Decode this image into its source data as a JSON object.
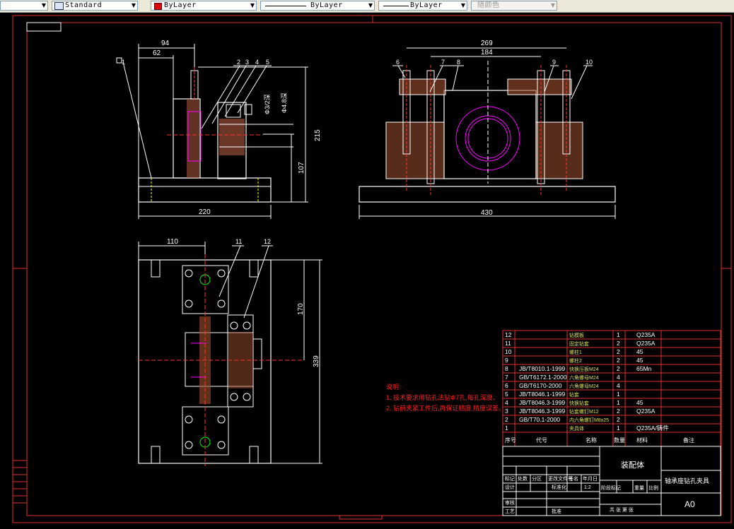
{
  "toolbar": {
    "textstyle": "Standard",
    "color": "ByLayer",
    "linetype": "ByLayer",
    "lineweight": "ByLayer",
    "plotstyle": "随颜色"
  },
  "drawing": {
    "front_view": {
      "dims": {
        "d94": "94",
        "d62": "62",
        "d220": "220",
        "d215": "215",
        "d107": "107",
        "phi": "Φ3/2深",
        "phi2": "Φ4.8深"
      },
      "balloons": [
        "1",
        "2",
        "3",
        "4",
        "5"
      ]
    },
    "side_view": {
      "dims": {
        "d269": "269",
        "d184": "184",
        "d430": "430"
      },
      "balloons": [
        "6",
        "7",
        "8",
        "9",
        "10"
      ]
    },
    "top_view": {
      "dims": {
        "d110": "110",
        "d170": "170",
        "d339": "339"
      },
      "balloons": [
        "11",
        "12"
      ]
    },
    "notes": {
      "title": "说明:",
      "line1": "1. 技术要求用钻孔法钻Φ7孔,每孔深度。",
      "line2": "2. 钻前夹紧工件后,再保证精度,精度误差。"
    },
    "bom": [
      {
        "no": "12",
        "code": "",
        "name": "钻模板",
        "qty": "1",
        "mat": "Q235A"
      },
      {
        "no": "11",
        "code": "",
        "name": "固定钻套",
        "qty": "2",
        "mat": "Q235A"
      },
      {
        "no": "10",
        "code": "",
        "name": "螺柱1",
        "qty": "2",
        "mat": "45"
      },
      {
        "no": "9",
        "code": "",
        "name": "螺柱2",
        "qty": "2",
        "mat": "45"
      },
      {
        "no": "8",
        "code": "JB/T8010.1-1999",
        "name": "快换压板M24",
        "qty": "2",
        "mat": "65Mn"
      },
      {
        "no": "7",
        "code": "GB/T6172.1-2000",
        "name": "六角螺母M24",
        "qty": "4",
        "mat": ""
      },
      {
        "no": "6",
        "code": "GB/T6170-2000",
        "name": "六角螺母M24",
        "qty": "4",
        "mat": ""
      },
      {
        "no": "5",
        "code": "JB/T8046.1-1999",
        "name": "钻套",
        "qty": "1",
        "mat": ""
      },
      {
        "no": "4",
        "code": "JB/T8046.3-1999",
        "name": "快换钻套",
        "qty": "1",
        "mat": "45"
      },
      {
        "no": "3",
        "code": "JB/T8046.3-1999",
        "name": "钻套螺钉M12",
        "qty": "2",
        "mat": "Q235A"
      },
      {
        "no": "2",
        "code": "GB/T70.1-2000",
        "name": "内六角螺钉M8x25",
        "qty": "2",
        "mat": ""
      },
      {
        "no": "1",
        "code": "",
        "name": "夹具体",
        "qty": "1",
        "mat": "Q235A/铸件"
      }
    ],
    "bom_header": {
      "no": "序号",
      "code": "代号",
      "name": "名称",
      "qty": "数量",
      "mat": "材料",
      "note": "备注"
    },
    "title_block": {
      "assembly": "装配体",
      "title": "轴承座钻孔夹具",
      "size": "A0",
      "r1": [
        "标记",
        "处数",
        "分区",
        "更改文件号",
        "签名",
        "年月日"
      ],
      "design": "设计",
      "std": "标准化",
      "check": "审核",
      "process": "工艺",
      "approve": "批准",
      "stage": "阶段标记",
      "weight": "重量",
      "scale": "比例",
      "scale_val": "1:2",
      "sheet": "共 张 第 张"
    }
  }
}
